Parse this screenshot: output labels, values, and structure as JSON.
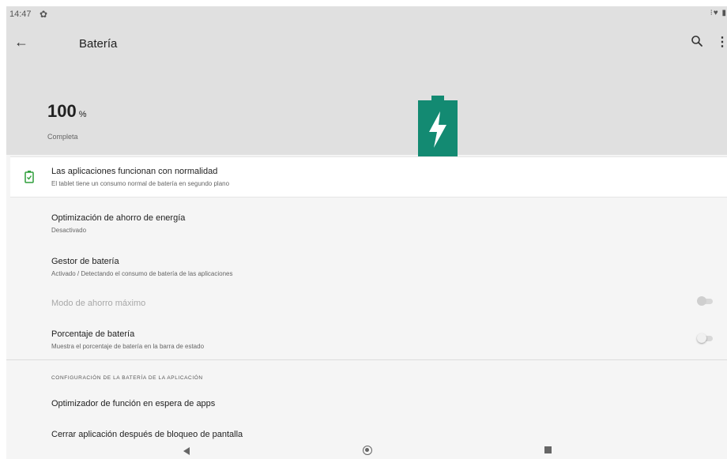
{
  "status_bar": {
    "time": "14:47",
    "gear_icon": "gear-icon",
    "right_icons": "⁝♥ ▮"
  },
  "app_bar": {
    "title": "Batería",
    "back_icon": "arrow-back-icon",
    "search_icon": "search-icon",
    "more_icon": "more-vert-icon"
  },
  "battery": {
    "level": "100",
    "unit": "%",
    "status": "Completa",
    "accent": "#138a72"
  },
  "status_card": {
    "title": "Las aplicaciones funcionan con normalidad",
    "subtitle": "El tablet tiene un consumo normal de batería en segundo plano",
    "accent": "#2e9e3a"
  },
  "items": [
    {
      "title": "Optimización de ahorro de energía",
      "subtitle": "Desactivado"
    },
    {
      "title": "Gestor de batería",
      "subtitle": "Activado / Detectando el consumo de batería de las aplicaciones"
    },
    {
      "title": "Modo de ahorro máximo",
      "enabled": false,
      "toggle": "off"
    },
    {
      "title": "Porcentaje de batería",
      "subtitle": "Muestra el porcentaje de batería en la barra de estado",
      "toggle": "off"
    }
  ],
  "section_header": "CONFIGURACIÓN DE LA BATERÍA DE LA APLICACIÓN",
  "section_items": [
    {
      "title": "Optimizador de función en espera de apps"
    },
    {
      "title": "Cerrar aplicación después de bloqueo de pantalla"
    }
  ],
  "nav_bar": {
    "back_icon": "nav-back-icon",
    "home_icon": "nav-home-icon",
    "recents_icon": "nav-recents-icon"
  }
}
